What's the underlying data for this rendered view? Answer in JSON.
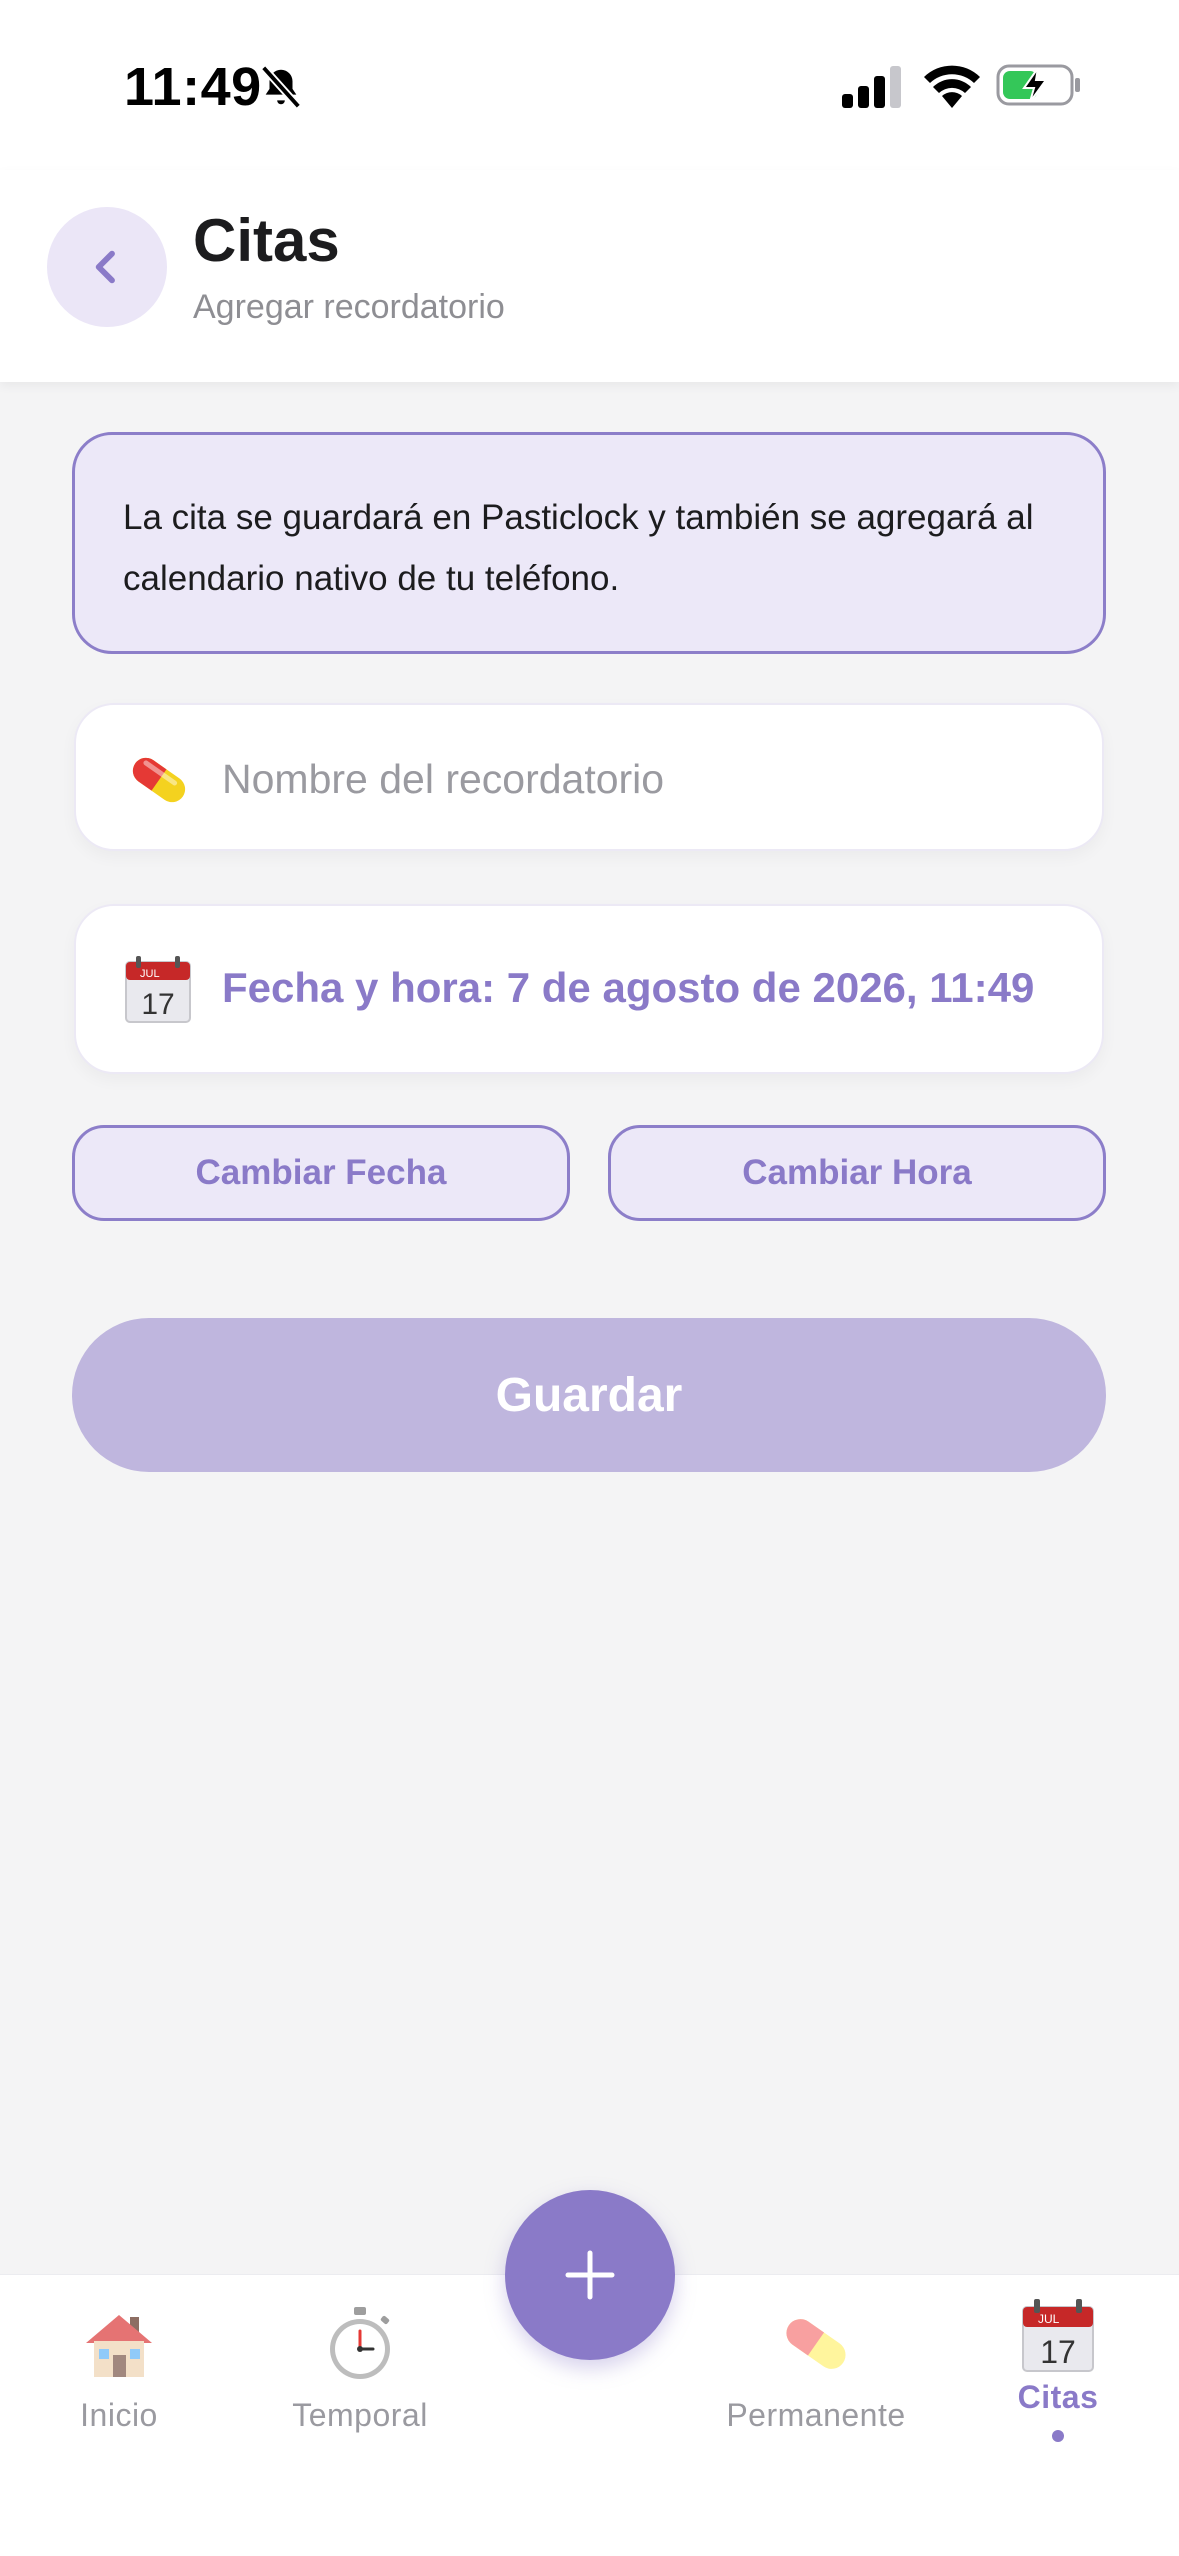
{
  "status_bar": {
    "time": "11:49",
    "icons": [
      "bell-slash-icon",
      "cellular-signal-icon",
      "wifi-icon",
      "battery-charging-icon"
    ]
  },
  "header": {
    "back_icon": "chevron-left-icon",
    "title": "Citas",
    "subtitle": "Agregar recordatorio"
  },
  "info": {
    "text": "La cita se guardará en Pasticlock y también se agregará al calendario nativo de tu teléfono."
  },
  "form": {
    "name_icon": "pill-icon",
    "name_value": "",
    "name_placeholder": "Nombre del recordatorio",
    "date_icon": "calendar-icon",
    "date_text": "Fecha y hora: 7 de agosto de 2026, 11:49",
    "change_date_label": "Cambiar Fecha",
    "change_time_label": "Cambiar Hora",
    "save_label": "Guardar"
  },
  "tab_bar": {
    "tabs": [
      {
        "label": "Inicio",
        "icon": "house-icon",
        "active": false
      },
      {
        "label": "Temporal",
        "icon": "stopwatch-icon",
        "active": false
      },
      {
        "label": "Permanente",
        "icon": "pill-icon",
        "active": false
      },
      {
        "label": "Citas",
        "icon": "calendar-icon",
        "active": true
      }
    ],
    "fab_icon": "plus-icon"
  },
  "colors": {
    "accent": "#8a7ac8",
    "accent_light": "#ece8f8",
    "save_disabled": "#bfb6de",
    "background": "#f4f4f5"
  }
}
